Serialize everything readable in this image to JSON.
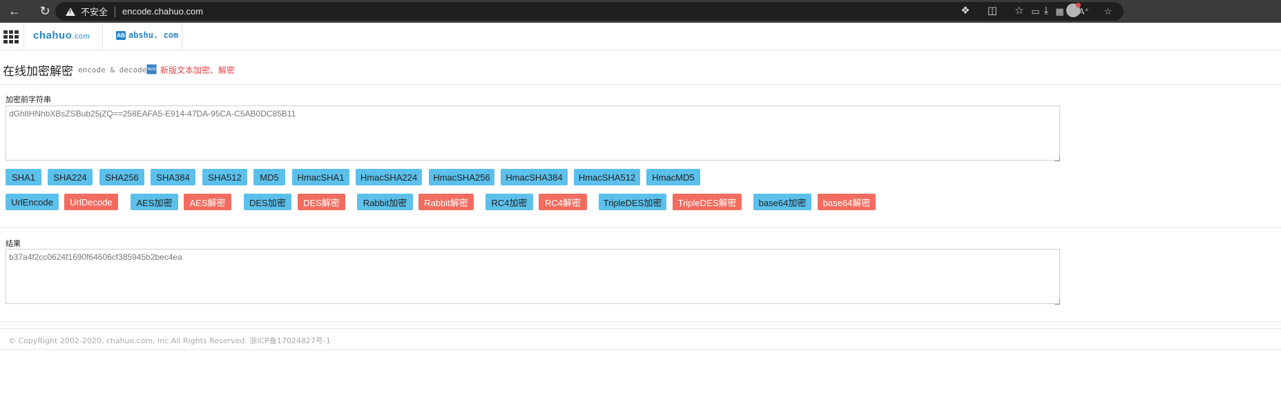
{
  "browser": {
    "insecure_label": "不安全",
    "url": "encode.chahuo.com"
  },
  "site": {
    "logo_main": "chahuo",
    "logo_suffix": ".com",
    "abshu_badge": "AB",
    "abshu_text": "abshu. com"
  },
  "page": {
    "title": "在线加密解密",
    "subtitle": "encode & decode",
    "new_icon_text": "NEW",
    "new_link": "新版文本加密、解密"
  },
  "input": {
    "label": "加密前字符串",
    "value": "dGhlIHNhbXBsZSBub25jZQ==258EAFA5-E914-47DA-95CA-C5AB0DC85B11"
  },
  "hash_buttons": [
    "SHA1",
    "SHA224",
    "SHA256",
    "SHA384",
    "SHA512",
    "MD5",
    "HmacSHA1",
    "HmacSHA224",
    "HmacSHA256",
    "HmacSHA384",
    "HmacSHA512",
    "HmacMD5"
  ],
  "codec_buttons": [
    {
      "label": "UrlEncode",
      "color": "blue"
    },
    {
      "label": "UrlDecode",
      "color": "red"
    },
    {
      "label": "AES加密",
      "color": "blue"
    },
    {
      "label": "AES解密",
      "color": "red"
    },
    {
      "label": "DES加密",
      "color": "blue"
    },
    {
      "label": "DES解密",
      "color": "red"
    },
    {
      "label": "Rabbit加密",
      "color": "blue"
    },
    {
      "label": "Rabbit解密",
      "color": "red"
    },
    {
      "label": "RC4加密",
      "color": "blue"
    },
    {
      "label": "RC4解密",
      "color": "red"
    },
    {
      "label": "TripleDES加密",
      "color": "blue"
    },
    {
      "label": "TripleDES解密",
      "color": "red"
    },
    {
      "label": "base64加密",
      "color": "blue"
    },
    {
      "label": "base64解密",
      "color": "red"
    }
  ],
  "result": {
    "label": "结果",
    "value": "b37a4f2cc0624f1690f64606cf385945b2bec4ea"
  },
  "footer": {
    "text": "© CopyRight 2002-2020, chahuo.com, Inc.All Rights Reserved. 浙ICP备17024827号-1"
  },
  "colors": {
    "blue_button": "#5bc0eb",
    "red_button": "#f26c5f",
    "link_red": "#e64545",
    "brand_blue": "#2a86c6"
  }
}
